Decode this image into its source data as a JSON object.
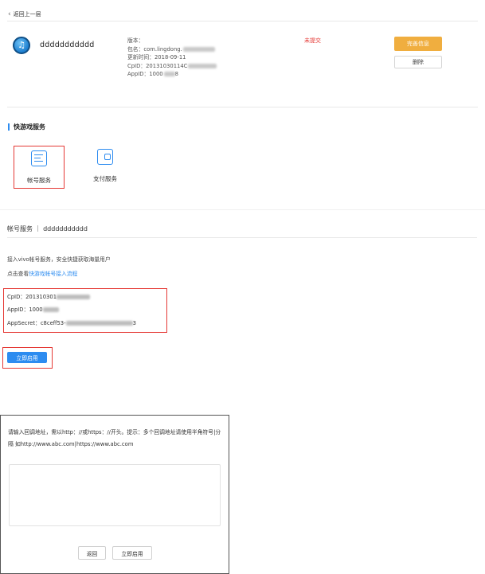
{
  "nav": {
    "back_label": "返回上一层"
  },
  "app": {
    "name": "ddddddddddd",
    "version_label": "版本：",
    "package_label": "包名：",
    "package_value": "com.lingdong.",
    "updated_label": "更新时间：",
    "updated_value": "2018-09-11",
    "cpid_label": "CpID：",
    "cpid_value": "20131030114C",
    "appid_label": "AppID：",
    "appid_value": "1000",
    "appid_tail": "8",
    "status": "未提交",
    "complete_button": "完善信息",
    "delete_button": "删除"
  },
  "services": {
    "title": "快游戏服务",
    "items": [
      {
        "label": "帐号服务",
        "icon": "account-card-icon"
      },
      {
        "label": "支付服务",
        "icon": "wallet-icon"
      }
    ]
  },
  "account": {
    "header": "帐号服务 ｜ ddddddddddd",
    "desc1": "接入vivo帐号服务，安全快捷获取海量用户",
    "desc2_prefix": "点击查看",
    "desc2_link": "快游戏帐号接入流程",
    "cpid_label": "CpID：",
    "cpid_value": "201310301",
    "appid_label": "AppID：",
    "appid_value": "1000",
    "secret_label": "AppSecret：",
    "secret_value": "c8ceff53-",
    "secret_tail": "3",
    "enable_button": "立即启用"
  },
  "dialog": {
    "text": "请输入回调地址，需以http：//或https：//开头。提示：多个回调地址请使用半角符号|分隔 如http://www.abc.com|https://www.abc.com",
    "back_button": "返回",
    "enable_button": "立即启用"
  },
  "colors": {
    "accent": "#2d8cf0",
    "orange": "#f0ae3f",
    "danger": "#e53935"
  }
}
